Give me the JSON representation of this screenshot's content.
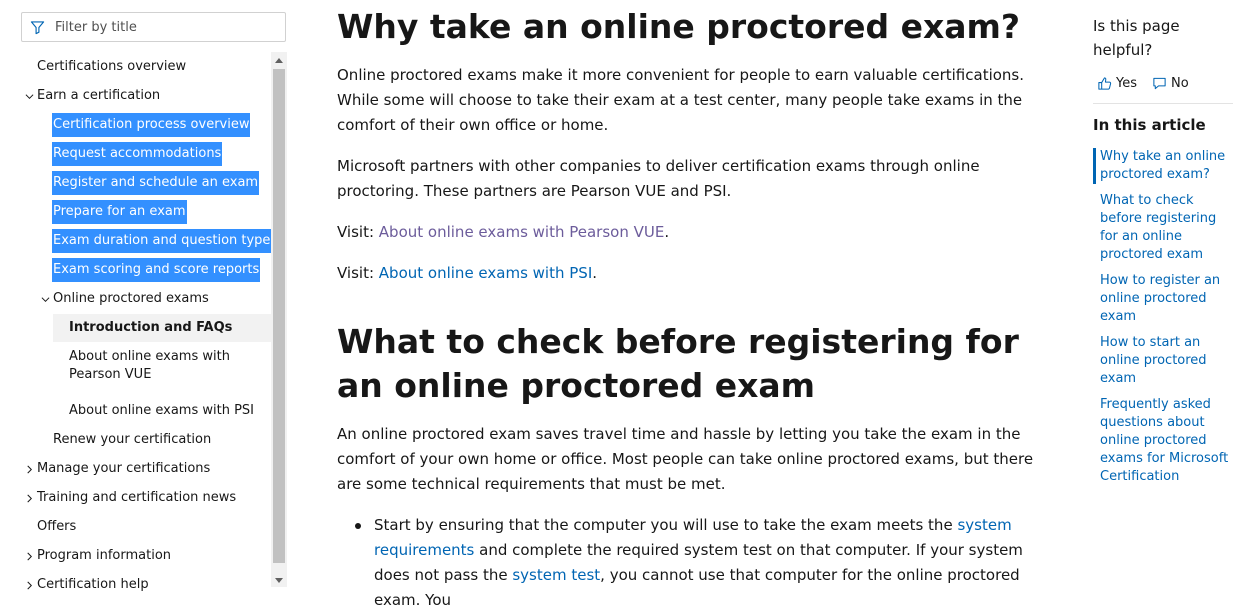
{
  "nav": {
    "filter_placeholder": "Filter by title",
    "items": [
      {
        "label": "Certifications overview",
        "chevron": "none"
      },
      {
        "label": "Earn a certification",
        "chevron": "down"
      },
      {
        "label": "Certification process overview",
        "selected": true
      },
      {
        "label": "Request accommodations",
        "selected": true
      },
      {
        "label": "Register and schedule an exam",
        "selected": true
      },
      {
        "label": "Prepare for an exam",
        "selected": true
      },
      {
        "label": "Exam duration and question types",
        "selected": true
      },
      {
        "label": "Exam scoring and score reports",
        "selected": true
      },
      {
        "label": "Online proctored exams",
        "chevron": "down"
      },
      {
        "label": "Introduction and FAQs",
        "current": true
      },
      {
        "label": "About online exams with Pearson VUE"
      },
      {
        "label": "About online exams with PSI"
      },
      {
        "label": "Renew your certification"
      },
      {
        "label": "Manage your certifications",
        "chevron": "right"
      },
      {
        "label": "Training and certification news",
        "chevron": "right"
      },
      {
        "label": "Offers",
        "chevron": "none"
      },
      {
        "label": "Program information",
        "chevron": "right"
      },
      {
        "label": "Certification help",
        "chevron": "right"
      }
    ]
  },
  "main": {
    "h1": "Why take an online proctored exam?",
    "p1": "Online proctored exams make it more convenient for people to earn valuable certifications. While some will choose to take their exam at a test center, many people take exams in the comfort of their own office or home.",
    "p2": "Microsoft partners with other companies to deliver certification exams through online proctoring. These partners are Pearson VUE and PSI.",
    "visit_prefix": "Visit: ",
    "visit1_link": "About online exams with Pearson VUE",
    "visit2_link": "About online exams with PSI",
    "period": ".",
    "h2": "What to check before registering for an online proctored exam",
    "p3": "An online proctored exam saves travel time and hassle by letting you take the exam in the comfort of your own home or office. Most people can take online proctored exams, but there are some technical requirements that must be met.",
    "bullet1": {
      "t1": "Start by ensuring that the computer you will use to take the exam meets the ",
      "link1": "system requirements",
      "t2": " and complete the required system test on that computer. If your system does not pass the ",
      "link2": "system test",
      "t3": ", you cannot use that computer for the online proctored exam. You"
    }
  },
  "rail": {
    "helpful_question": "Is this page helpful?",
    "yes_label": "Yes",
    "no_label": "No",
    "in_this_article": "In this article",
    "toc": [
      "Why take an online proctored exam?",
      "What to check before registering for an online proctored exam",
      "How to register an online proctored exam",
      "How to start an online proctored exam",
      "Frequently asked questions about online proctored exams for Microsoft Certification"
    ]
  },
  "colors": {
    "selection": "#3390ff",
    "link": "#0065b3",
    "visited_link": "#6c5c9b",
    "current_item_bg": "#f2f2f2"
  }
}
